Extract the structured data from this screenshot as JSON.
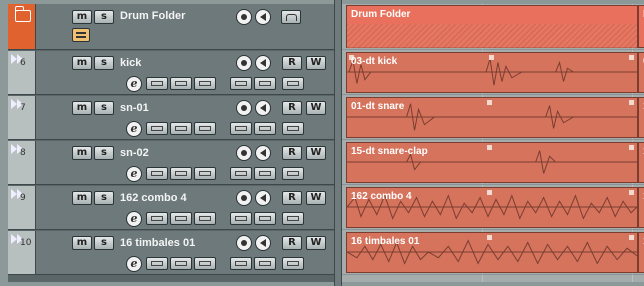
{
  "folder": {
    "name": "Drum Folder",
    "event_name": "Drum Folder",
    "event_name_2": "D",
    "mute": "m",
    "solo": "s"
  },
  "tracks": [
    {
      "num": "6",
      "name": "kick",
      "event": "03-dt kick",
      "event2": "0",
      "mute": "m",
      "solo": "s",
      "r": "R",
      "w": "W"
    },
    {
      "num": "7",
      "name": "sn-01",
      "event": "01-dt snare",
      "event2": "1",
      "mute": "m",
      "solo": "s",
      "r": "R",
      "w": "W"
    },
    {
      "num": "8",
      "name": "sn-02",
      "event": "15-dt snare-clap",
      "event2": "1",
      "mute": "m",
      "solo": "s",
      "r": "R",
      "w": "W"
    },
    {
      "num": "9",
      "name": "162 combo 4",
      "event": "162 combo 4",
      "event2": "1",
      "mute": "m",
      "solo": "s",
      "r": "R",
      "w": "W"
    },
    {
      "num": "10",
      "name": "16 timbales 01",
      "event": "16 timbales 01",
      "event2": "1",
      "mute": "m",
      "solo": "s",
      "r": "R",
      "w": "W"
    }
  ],
  "edit_label": "e",
  "colors": {
    "folder_accent": "#e0622f",
    "event": "#d5735c"
  }
}
